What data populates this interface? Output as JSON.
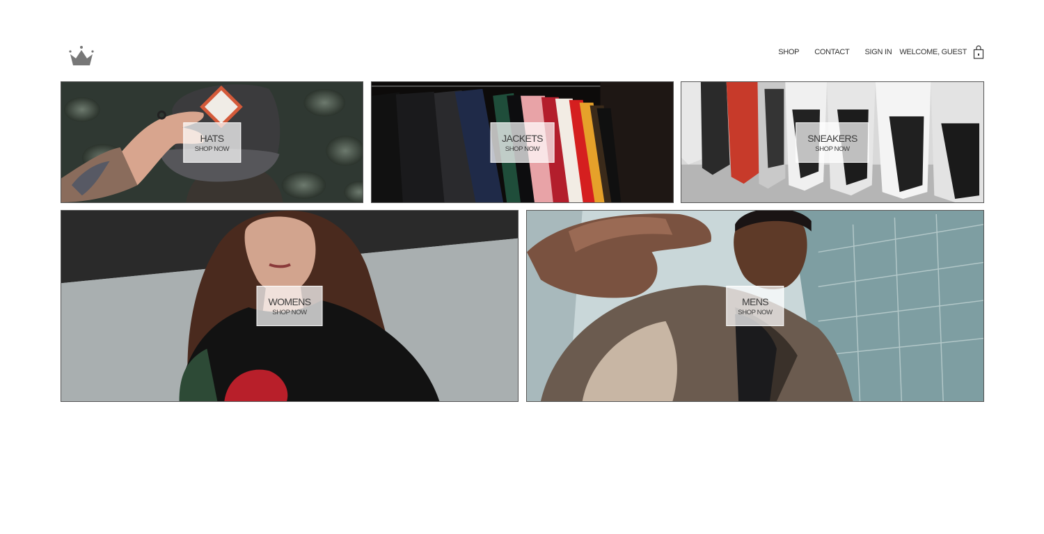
{
  "header": {
    "logo_icon": "crown-icon",
    "nav": {
      "shop": "SHOP",
      "contact": "CONTACT",
      "sign_in": "SIGN IN",
      "welcome": "WELCOME, GUEST",
      "bag_icon": "shopping-bag-icon"
    }
  },
  "directory": {
    "hats": {
      "title": "HATS",
      "subtitle": "SHOP NOW"
    },
    "jackets": {
      "title": "JACKETS",
      "subtitle": "SHOP NOW"
    },
    "sneakers": {
      "title": "SNEAKERS",
      "subtitle": "SHOP NOW"
    },
    "womens": {
      "title": "WOMENS",
      "subtitle": "SHOP NOW"
    },
    "mens": {
      "title": "MENS",
      "subtitle": "SHOP NOW"
    }
  },
  "colors": {
    "label_box": "#ffffff",
    "text": "#333333",
    "logo": "#777777"
  }
}
